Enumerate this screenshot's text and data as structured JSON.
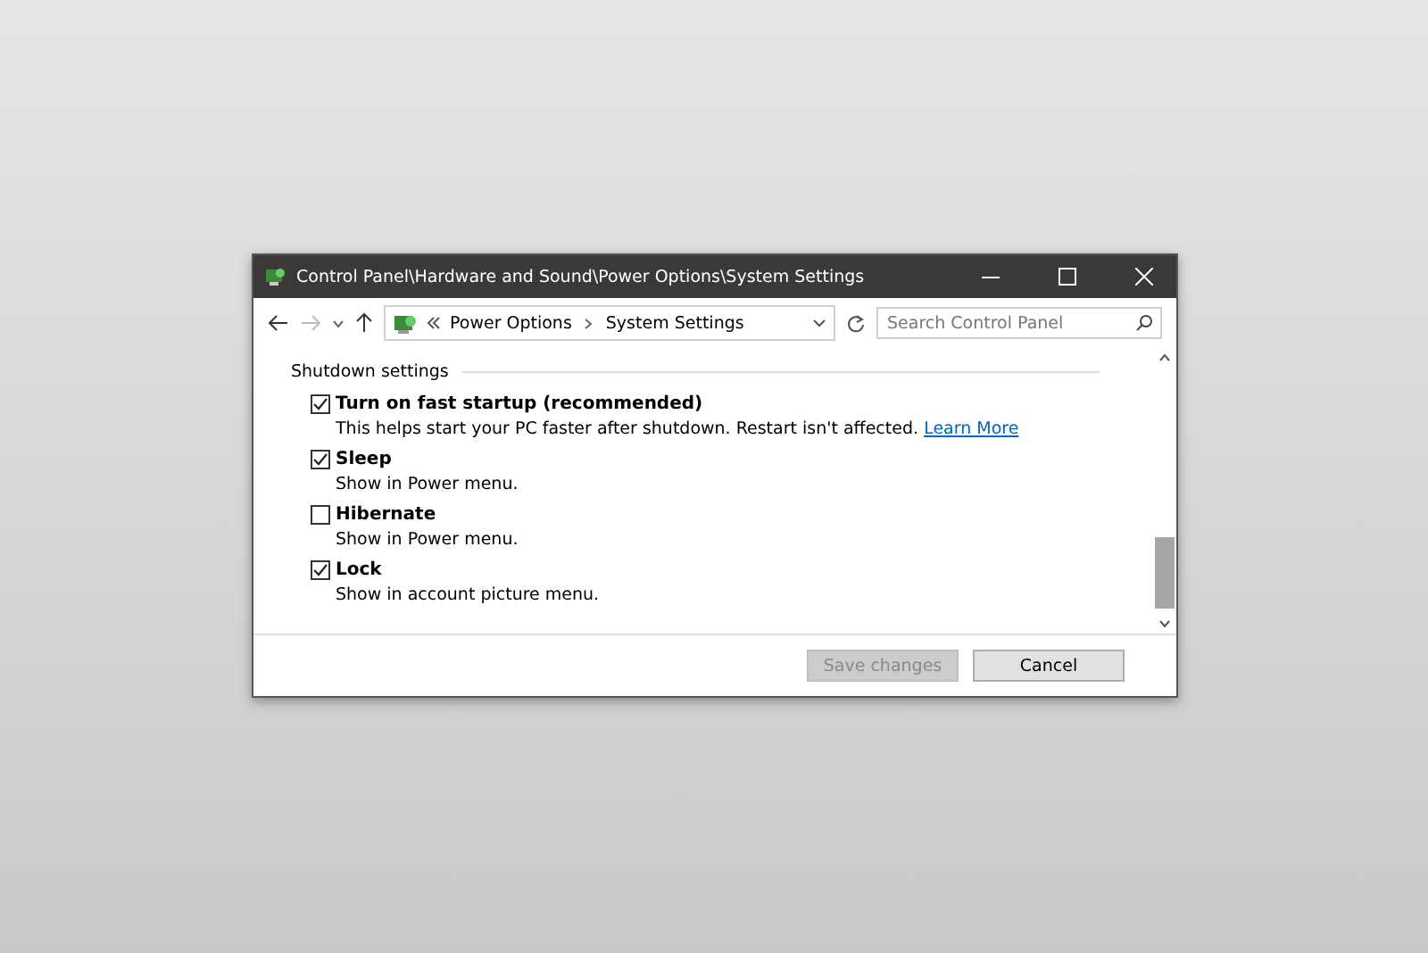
{
  "window": {
    "title": "Control Panel\\Hardware and Sound\\Power Options\\System Settings"
  },
  "address_bar": {
    "path": [
      "Power Options",
      "System Settings"
    ]
  },
  "search": {
    "placeholder": "Search Control Panel"
  },
  "section": {
    "title": "Shutdown settings"
  },
  "options": [
    {
      "label": "Turn on fast startup (recommended)",
      "description": "This helps start your PC faster after shutdown. Restart isn't affected.",
      "link": "Learn More",
      "checked": true
    },
    {
      "label": "Sleep",
      "description": "Show in Power menu.",
      "checked": true
    },
    {
      "label": "Hibernate",
      "description": "Show in Power menu.",
      "checked": false
    },
    {
      "label": "Lock",
      "description": "Show in account picture menu.",
      "checked": true
    }
  ],
  "buttons": [
    {
      "label": "Save changes",
      "disabled": true
    },
    {
      "label": "Cancel",
      "disabled": false
    }
  ]
}
